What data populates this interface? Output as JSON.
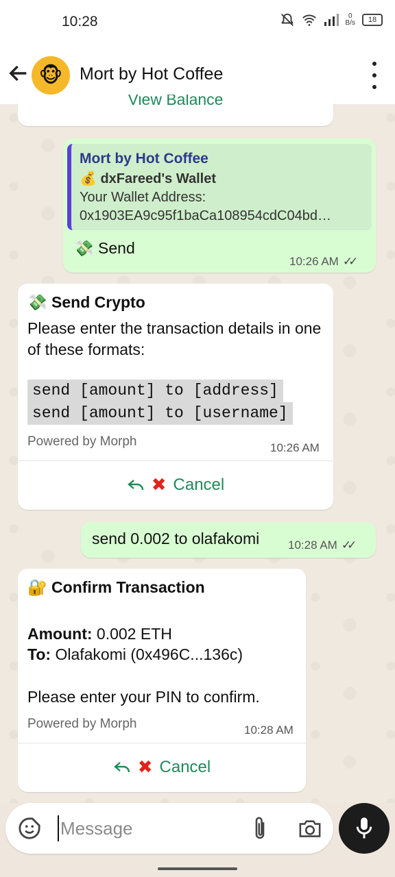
{
  "status_bar": {
    "time": "10:28",
    "net_speed_value": "0",
    "net_speed_unit": "B/s",
    "battery": "18"
  },
  "header": {
    "chat_title": "Mort by Hot Coffee",
    "avatar_emoji": "🐵"
  },
  "messages": {
    "partial_button": "View Balance",
    "quote": {
      "title": "Mort by Hot Coffee",
      "wallet_line": "💰 dxFareed's Wallet",
      "address_label": "Your Wallet Address:",
      "address_value": "0x1903EA9c95f1baCa108954cdC04bd…"
    },
    "send_cmd": {
      "emoji": "💸",
      "text": "Send",
      "time": "10:26 AM"
    },
    "send_crypto": {
      "emoji": "💸",
      "title": "Send Crypto",
      "body": "Please enter the transaction details in one of these formats:",
      "format_1": "send [amount] to [address]",
      "format_2": "send [amount] to [username]",
      "powered": "Powered by Morph",
      "time": "10:26 AM",
      "cancel_label": "Cancel"
    },
    "user_send": {
      "text": "send 0.002 to olafakomi",
      "time": "10:28 AM"
    },
    "confirm": {
      "emoji": "🔐",
      "title": "Confirm Transaction",
      "amount_label": "Amount:",
      "amount_value": "0.002 ETH",
      "to_label": "To:",
      "to_value": "Olafakomi (0x496C...136c)",
      "pin_text": "Please enter your PIN to confirm.",
      "powered": "Powered by Morph",
      "time": "10:28 AM",
      "cancel_label": "Cancel"
    }
  },
  "composer": {
    "placeholder": "Message"
  },
  "colors": {
    "accent_green": "#1f8a5b",
    "out_bubble": "#d9fdd3",
    "quote_bar": "#5b3fd6",
    "cancel_x": "#e0241c"
  }
}
